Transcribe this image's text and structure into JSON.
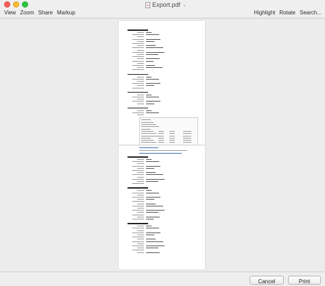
{
  "window": {
    "title": "Export.pdf",
    "file_icon": "pdf-file-icon",
    "title_chevron": "⌄"
  },
  "toolbar": {
    "left_items": [
      "View",
      "Zoom",
      "Share",
      "Markup"
    ],
    "right_items": [
      "Highlight",
      "Rotate",
      "Search..."
    ]
  },
  "footer": {
    "cancel_label": "Cancel",
    "print_label": "Print"
  },
  "colors": {
    "close": "#fc5f57",
    "minimize": "#fdbc2e",
    "zoom": "#28c840",
    "window_bg": "#efefef",
    "page_bg": "#ffffff"
  }
}
